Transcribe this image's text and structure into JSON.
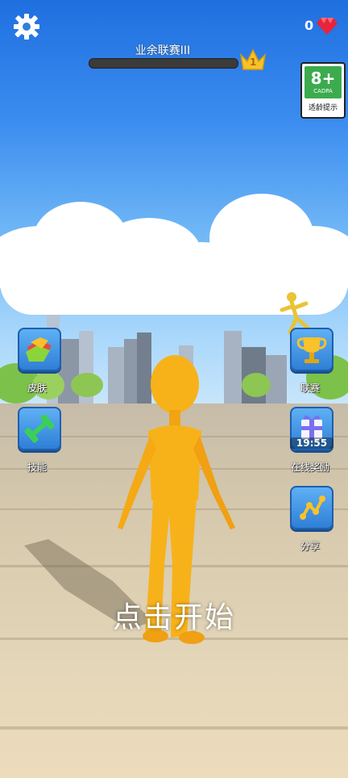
{
  "hud": {
    "gem_count": "0",
    "league_title": "业余联赛III",
    "league_progress": 0,
    "crown_rank": "1"
  },
  "age_rating": {
    "rating": "8+",
    "org": "CADPA",
    "caption": "适龄提示"
  },
  "left_menu": [
    {
      "label": "皮肤",
      "icon": "skins-icon"
    },
    {
      "label": "技能",
      "icon": "dumbbell-icon"
    }
  ],
  "right_menu": [
    {
      "label": "联赛",
      "icon": "trophy-icon"
    },
    {
      "label": "在线奖励",
      "icon": "gift-icon",
      "timer": "19:55"
    },
    {
      "label": "分享",
      "icon": "share-icon"
    }
  ],
  "start_prompt": "点击开始",
  "colors": {
    "button_blue": "#3d8ef0",
    "gem_red": "#e8243a",
    "character_orange": "#f7b21a"
  }
}
